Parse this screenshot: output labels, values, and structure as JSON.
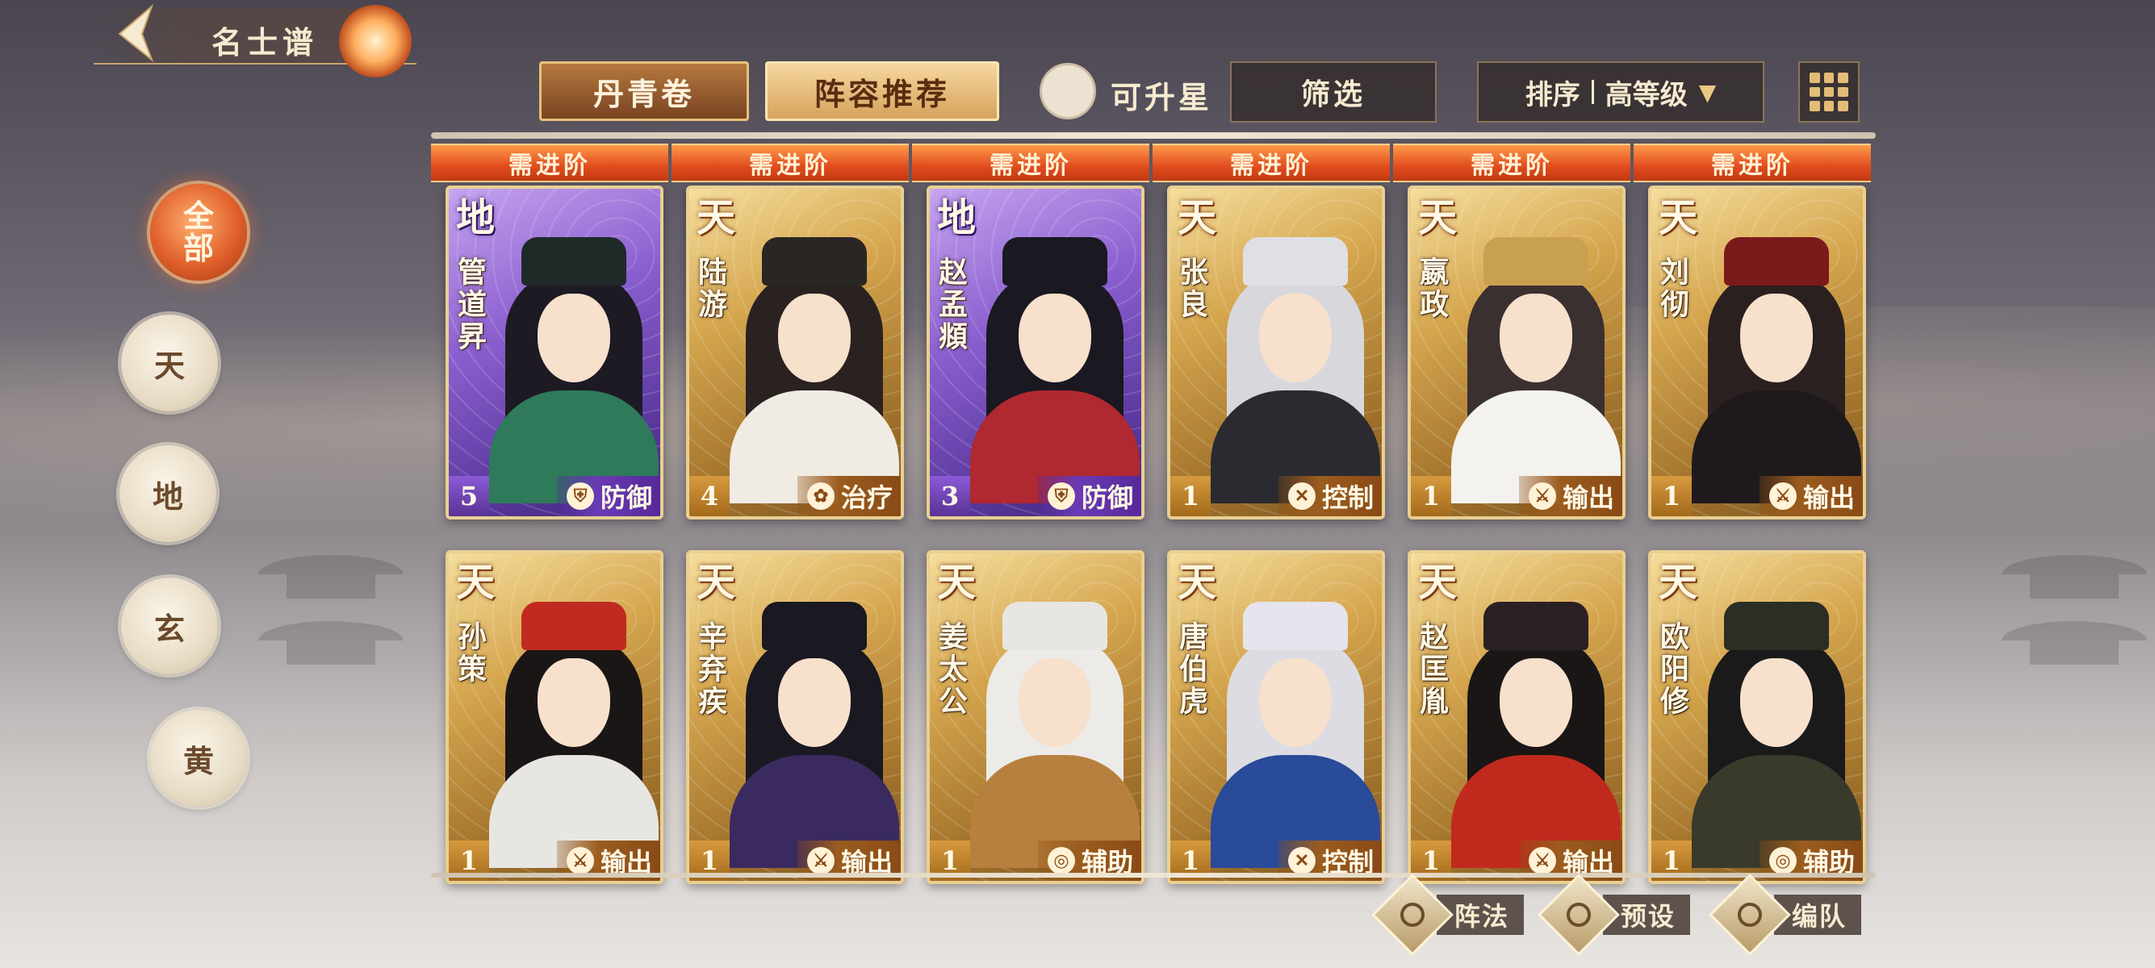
{
  "header": {
    "title": "名士谱"
  },
  "toolbar": {
    "danqing_label": "丹青卷",
    "zhenrong_label": "阵容推荐",
    "upgradable_label": "可升星",
    "filter_label": "筛选",
    "sort_label": "排序",
    "sort_value": "高等级"
  },
  "categories": [
    {
      "label": "全部",
      "active": true
    },
    {
      "label": "天",
      "active": false
    },
    {
      "label": "地",
      "active": false
    },
    {
      "label": "玄",
      "active": false
    },
    {
      "label": "黄",
      "active": false
    }
  ],
  "column_banner": "需进阶",
  "cards": [
    {
      "grade": "地",
      "name": "管道昇",
      "level": "5",
      "role": "防御",
      "role_icon": "shield-icon",
      "rarity": "purple",
      "hair": "#1d1a24",
      "robe": "#2e7a5a",
      "hat": "#1f2a28"
    },
    {
      "grade": "天",
      "name": "陆游",
      "level": "4",
      "role": "治疗",
      "role_icon": "sprout-icon",
      "rarity": "gold",
      "hair": "#2a2220",
      "robe": "#f0ece4",
      "hat": "#2a2624"
    },
    {
      "grade": "地",
      "name": "赵孟頫",
      "level": "3",
      "role": "防御",
      "role_icon": "shield-icon",
      "rarity": "purple",
      "hair": "#1a1820",
      "robe": "#b02830",
      "hat": "#1a1820"
    },
    {
      "grade": "天",
      "name": "张良",
      "level": "1",
      "role": "控制",
      "role_icon": "cross-swords-icon",
      "rarity": "gold",
      "hair": "#d8d8dc",
      "robe": "#2a2a30",
      "hat": "#e0e0e4"
    },
    {
      "grade": "天",
      "name": "嬴政",
      "level": "1",
      "role": "输出",
      "role_icon": "sword-icon",
      "rarity": "gold",
      "hair": "#3a3030",
      "robe": "#f4f2ee",
      "hat": "#c8a050"
    },
    {
      "grade": "天",
      "name": "刘彻",
      "level": "1",
      "role": "输出",
      "role_icon": "sword-icon",
      "rarity": "gold",
      "hair": "#2a2020",
      "robe": "#1e1a1c",
      "hat": "#7a1a1a"
    },
    {
      "grade": "天",
      "name": "孙策",
      "level": "1",
      "role": "输出",
      "role_icon": "sword-icon",
      "rarity": "gold",
      "hair": "#1a1616",
      "robe": "#e8e6e2",
      "hat": "#c02a20"
    },
    {
      "grade": "天",
      "name": "辛弃疾",
      "level": "1",
      "role": "输出",
      "role_icon": "sword-icon",
      "rarity": "gold",
      "hair": "#1a1820",
      "robe": "#3a2a60",
      "hat": "#1a1820"
    },
    {
      "grade": "天",
      "name": "姜太公",
      "level": "1",
      "role": "辅助",
      "role_icon": "swirl-icon",
      "rarity": "gold",
      "hair": "#ecebe8",
      "robe": "#b8803e",
      "hat": "#e8e6e2"
    },
    {
      "grade": "天",
      "name": "唐伯虎",
      "level": "1",
      "role": "控制",
      "role_icon": "cross-swords-icon",
      "rarity": "gold",
      "hair": "#dcdce2",
      "robe": "#2a4a9a",
      "hat": "#e6e4ec"
    },
    {
      "grade": "天",
      "name": "赵匡胤",
      "level": "1",
      "role": "输出",
      "role_icon": "sword-icon",
      "rarity": "gold",
      "hair": "#1a1616",
      "robe": "#c02a1c",
      "hat": "#2a2024"
    },
    {
      "grade": "天",
      "name": "欧阳修",
      "level": "1",
      "role": "辅助",
      "role_icon": "swirl-icon",
      "rarity": "gold",
      "hair": "#1a1a1a",
      "robe": "#3a3a2a",
      "hat": "#2a2e24"
    }
  ],
  "actions": [
    {
      "label": "阵法",
      "icon": "formation-icon"
    },
    {
      "label": "预设",
      "icon": "preset-icon"
    },
    {
      "label": "编队",
      "icon": "team-icon"
    }
  ]
}
